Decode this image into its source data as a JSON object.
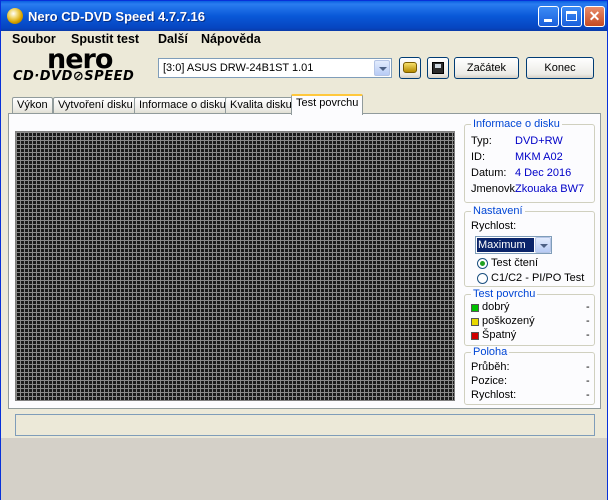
{
  "window": {
    "title": "Nero CD-DVD Speed 4.7.7.16"
  },
  "menu": [
    "Soubor",
    "Spustit test",
    "Další",
    "Nápověda"
  ],
  "logo": {
    "line1": "nero",
    "line2": "CD·DVD⊘SPEED"
  },
  "drive": {
    "selected": "[3:0]   ASUS DRW-24B1ST  1.01"
  },
  "buttons": {
    "start": "Začátek",
    "end": "Konec"
  },
  "tabs": [
    {
      "label": "Výkon",
      "active": false
    },
    {
      "label": "Vytvoření disku",
      "active": false
    },
    {
      "label": "Informace o disku",
      "active": false
    },
    {
      "label": "Kvalita disku",
      "active": false
    },
    {
      "label": "Test povrchu",
      "active": true
    }
  ],
  "disc_info": {
    "title": "Informace o disku",
    "rows": [
      {
        "label": "Typ:",
        "value": "DVD+RW"
      },
      {
        "label": "ID:",
        "value": "MKM A02"
      },
      {
        "label": "Datum:",
        "value": "4 Dec 2016"
      },
      {
        "label": "Jmenovk",
        "value": "Zkouaka BW7"
      }
    ]
  },
  "settings": {
    "title": "Nastavení",
    "speed_label": "Rychlost:",
    "speed_value": "Maximum",
    "options": [
      {
        "label": "Test čtení",
        "selected": true
      },
      {
        "label": "C1/C2 - PI/PO Test",
        "selected": false
      }
    ]
  },
  "surface_legend": {
    "title": "Test povrchu",
    "items": [
      {
        "label": "dobrý",
        "value": "-",
        "color": "#00c000"
      },
      {
        "label": "poškozený",
        "value": "-",
        "color": "#e8d800"
      },
      {
        "label": "Špatný",
        "value": "-",
        "color": "#d00000"
      }
    ]
  },
  "position": {
    "title": "Poloha",
    "rows": [
      {
        "label": "Průběh:",
        "value": "-"
      },
      {
        "label": "Pozice:",
        "value": "-"
      },
      {
        "label": "Rychlost:",
        "value": "-"
      }
    ]
  }
}
